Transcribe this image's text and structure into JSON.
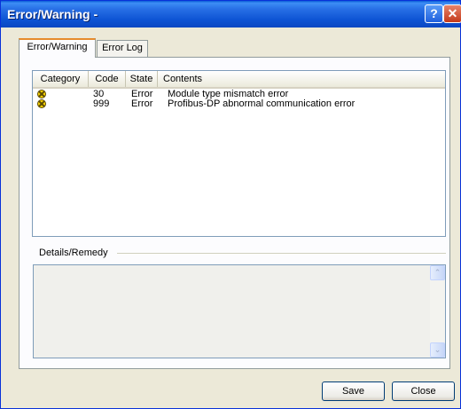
{
  "window": {
    "title": "Error/Warning -",
    "help_glyph": "?",
    "close_glyph": "✕"
  },
  "tabs": [
    {
      "label": "Error/Warning",
      "active": true
    },
    {
      "label": "Error Log",
      "active": false
    }
  ],
  "list": {
    "columns": [
      "Category",
      "Code",
      "State",
      "Contents"
    ],
    "rows": [
      {
        "category_icon": "error-circle-icon",
        "code": "30",
        "state": "Error",
        "contents": "Module type mismatch error"
      },
      {
        "category_icon": "error-circle-icon",
        "code": "999",
        "state": "Error",
        "contents": "Profibus-DP abnormal communication error"
      }
    ]
  },
  "details": {
    "label": "Details/Remedy",
    "text": ""
  },
  "scrollbar": {
    "up_glyph": "⌃",
    "down_glyph": "⌄"
  },
  "buttons": {
    "save": "Save",
    "close": "Close"
  },
  "colors": {
    "titlebar": "#0a54d6",
    "active_tab_accent": "#e68b2c",
    "error_icon_fill": "#ffd700"
  }
}
